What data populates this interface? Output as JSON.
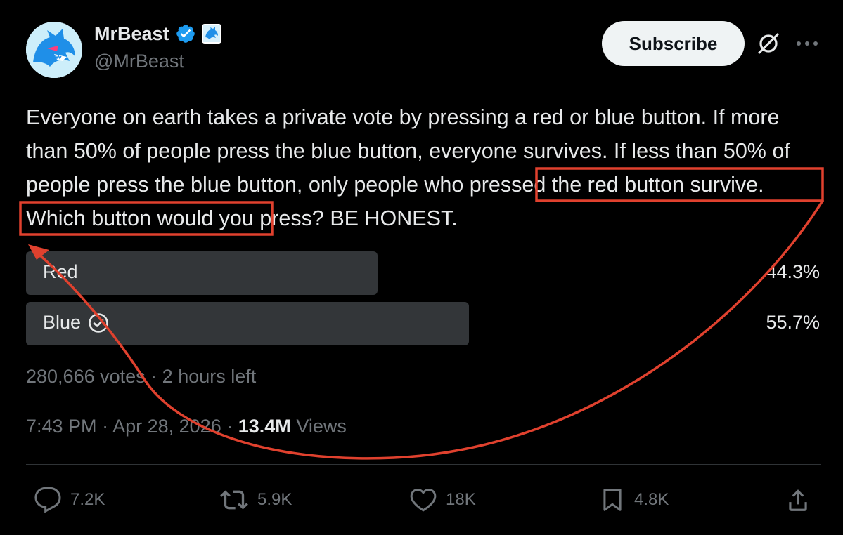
{
  "author": {
    "name": "MrBeast",
    "handle": "@MrBeast",
    "avatar_icon": "mrbeast-panther-logo",
    "verified_color": "#1d9bf0"
  },
  "header_actions": {
    "subscribe_label": "Subscribe",
    "grok_icon": "grok-icon",
    "more_icon": "more-horizontal-icon"
  },
  "tweet": {
    "text_part1": "Everyone on earth takes a private vote by pressing a red or blue button. If more than 50% of people press the blue button, everyone survives. If less than 50% of people press the blue button, ",
    "text_highlight_line1": "only people who pressed",
    "text_highlight_line2": "the red button survive.",
    "text_part2": " Which button would you press? BE HONEST."
  },
  "poll": {
    "options": [
      {
        "label": "Red",
        "percent_text": "44.3%",
        "percent": 44.3,
        "selected": false
      },
      {
        "label": "Blue",
        "percent_text": "55.7%",
        "percent": 55.7,
        "selected": true
      }
    ],
    "votes": "280,666 votes",
    "separator": "·",
    "time_left": "2 hours left",
    "bar_color": "#333639"
  },
  "meta": {
    "time": "7:43 PM",
    "date": "Apr 28, 2026",
    "separator": "·",
    "views_count": "13.4M",
    "views_label": "Views"
  },
  "actions": {
    "replies": "7.2K",
    "reposts": "5.9K",
    "likes": "18K",
    "bookmarks": "4.8K"
  },
  "annotation": {
    "color": "#e0412e"
  }
}
